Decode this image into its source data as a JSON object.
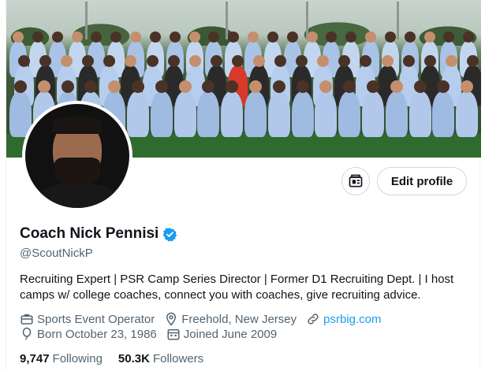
{
  "profile": {
    "name": "Coach Nick Pennisi",
    "handle": "@ScoutNickP",
    "bio": "Recruiting Expert | PSR Camp Series Director | Former D1 Recruiting Dept. | I host camps w/ college coaches, connect you with coaches, give recruiting advice.",
    "category": "Sports Event Operator",
    "location": "Freehold, New Jersey",
    "website": "psrbig.com",
    "birthday": "Born October 23, 1986",
    "joined": "Joined June 2009",
    "following_count": "9,747",
    "following_label": "Following",
    "followers_count": "50.3K",
    "followers_label": "Followers",
    "verified": true
  },
  "actions": {
    "edit_profile_label": "Edit profile",
    "pro_tools_icon": "professional-tools-icon"
  },
  "colors": {
    "accent": "#1d9bf0",
    "text_primary": "#0f1419",
    "text_secondary": "#536471",
    "border": "#cfd9de"
  },
  "icons": {
    "category": "briefcase-icon",
    "location": "location-pin-icon",
    "website": "link-icon",
    "birthday": "balloon-icon",
    "joined": "calendar-icon",
    "verified": "verified-badge-icon"
  }
}
